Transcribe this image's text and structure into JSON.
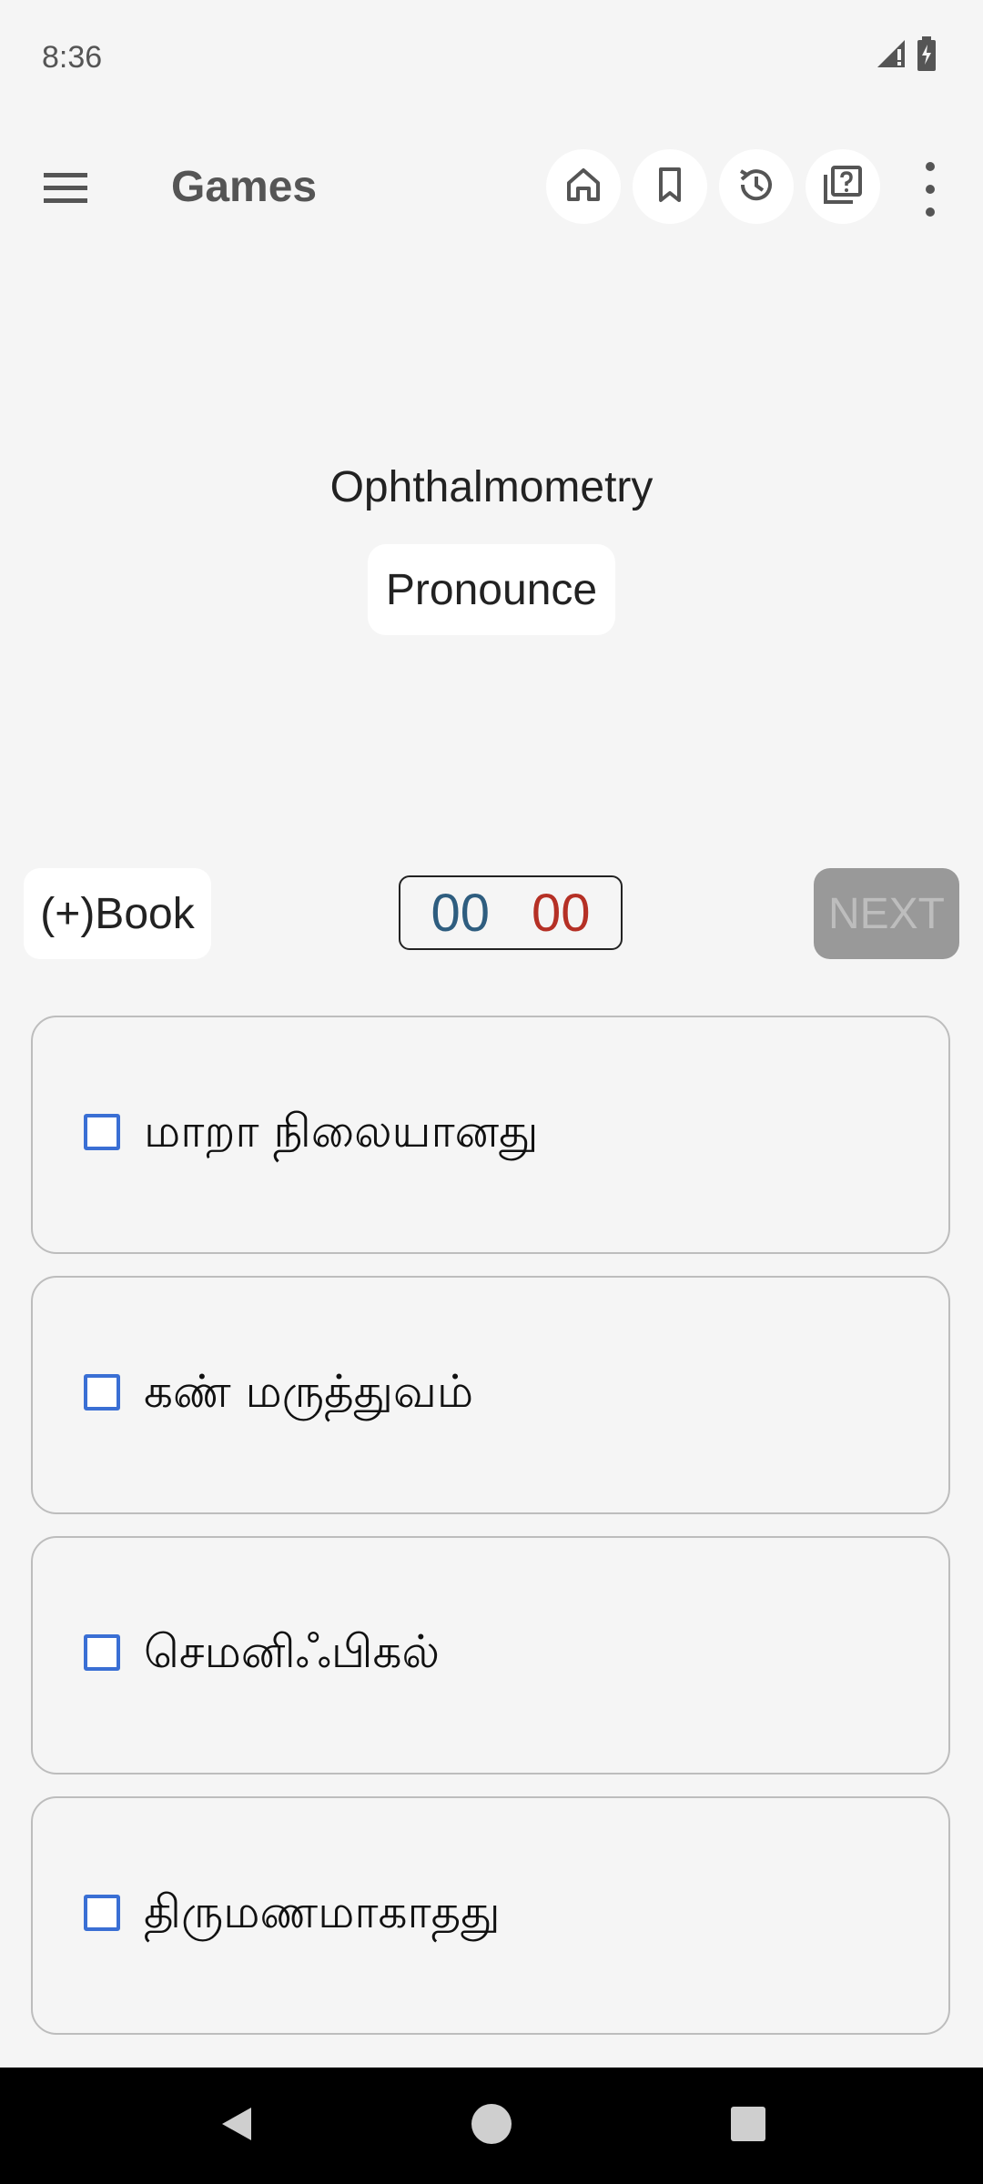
{
  "status": {
    "time": "8:36"
  },
  "app_bar": {
    "title": "Games"
  },
  "question": {
    "word": "Ophthalmometry",
    "pronounce_label": "Pronounce"
  },
  "controls": {
    "book_label": "(+)Book",
    "correct_count": "00",
    "wrong_count": "00",
    "next_label": "NEXT"
  },
  "options": [
    {
      "label": "மாறா நிலையானது"
    },
    {
      "label": "கண் மருத்துவம்"
    },
    {
      "label": "செமனிஃபிகல்"
    },
    {
      "label": "திருமணமாகாதது"
    }
  ],
  "colors": {
    "checkbox": "#3a6fd4",
    "correct": "#2e5d7f",
    "wrong": "#b53025",
    "next_disabled_bg": "#999999"
  },
  "icons": [
    "menu-icon",
    "home-icon",
    "bookmark-icon",
    "history-icon",
    "quiz-icon",
    "more-vert-icon",
    "signal-icon",
    "battery-icon",
    "back-icon",
    "home-nav-icon",
    "recents-icon"
  ]
}
